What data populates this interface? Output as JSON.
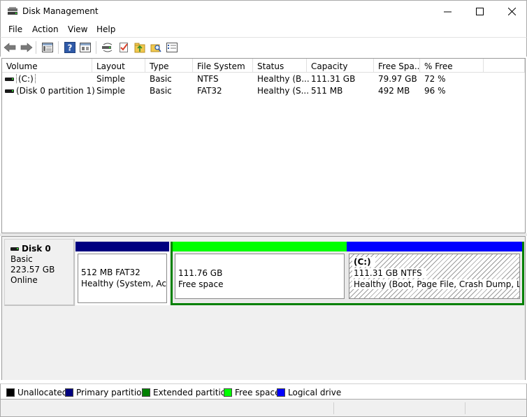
{
  "window": {
    "title": "Disk Management"
  },
  "menu": [
    "File",
    "Action",
    "View",
    "Help"
  ],
  "toolbar": [
    "back-arrow",
    "forward-arrow",
    "disk-list-view",
    "help",
    "properties",
    "rescan-disks",
    "check-disk",
    "export",
    "search",
    "settings"
  ],
  "volume_table": {
    "columns": [
      "Volume",
      "Layout",
      "Type",
      "File System",
      "Status",
      "Capacity",
      "Free Spa...",
      "% Free"
    ],
    "rows": [
      [
        "(C:)",
        "Simple",
        "Basic",
        "NTFS",
        "Healthy (B...",
        "111.31 GB",
        "79.97 GB",
        "72 %"
      ],
      [
        "(Disk 0 partition 1)",
        "Simple",
        "Basic",
        "FAT32",
        "Healthy (S...",
        "511 MB",
        "492 MB",
        "96 %"
      ]
    ]
  },
  "disk": {
    "name": "Disk 0",
    "type": "Basic",
    "size": "223.57 GB",
    "state": "Online",
    "partitions": [
      {
        "label": "",
        "line1": "512 MB FAT32",
        "line2": "Healthy (System, Activ",
        "kind": "primary",
        "color": "#000080"
      },
      {
        "label": "",
        "line1": "111.76 GB",
        "line2": "Free space",
        "kind": "free",
        "color": "#00ff00"
      },
      {
        "label": "(C:)",
        "line1": "111.31 GB NTFS",
        "line2": "Healthy (Boot, Page File, Crash Dump, Logic",
        "kind": "logical",
        "color": "#0000ff"
      }
    ]
  },
  "legend": [
    {
      "label": "Unallocated",
      "color": "#000000"
    },
    {
      "label": "Primary partition",
      "color": "#000080"
    },
    {
      "label": "Extended partition",
      "color": "#008000"
    },
    {
      "label": "Free space",
      "color": "#00ff00"
    },
    {
      "label": "Logical drive",
      "color": "#0000ff"
    }
  ]
}
